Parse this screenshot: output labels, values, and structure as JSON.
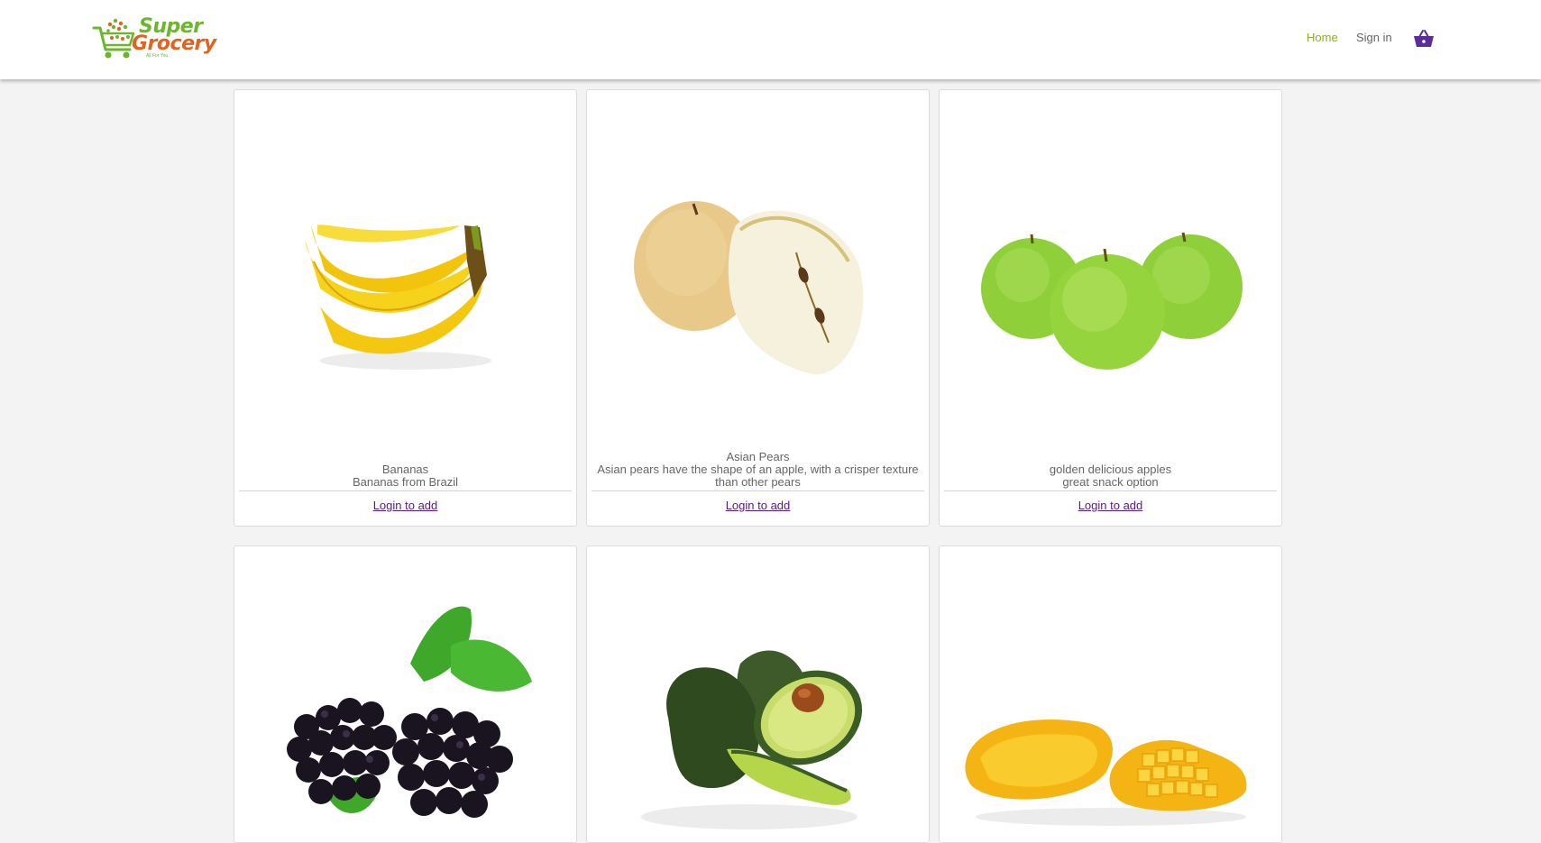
{
  "brand": {
    "name_line1": "Super",
    "name_line2": "Grocery",
    "tagline": "All For You"
  },
  "nav": {
    "home_label": "Home",
    "signin_label": "Sign in",
    "cart_icon": "basket-icon"
  },
  "colors": {
    "accent_green": "#8db10f",
    "link_visited": "#551a8b",
    "cart_purple": "#5b2d9a",
    "logo_green": "#6cb52d",
    "logo_orange": "#e2631f"
  },
  "products": [
    {
      "title": "Bananas",
      "description": "Bananas from Brazil",
      "action": "Login to add",
      "image": "bananas-image"
    },
    {
      "title": "Asian Pears",
      "description": "Asian pears have the shape of an apple, with a crisper texture than other pears",
      "action": "Login to add",
      "image": "asian-pears-image"
    },
    {
      "title": "golden delicious apples",
      "description": "great snack option",
      "action": "Login to add",
      "image": "green-apples-image"
    },
    {
      "title": "",
      "description": "",
      "action": "",
      "image": "blackberries-image"
    },
    {
      "title": "",
      "description": "",
      "action": "",
      "image": "avocados-image"
    },
    {
      "title": "",
      "description": "",
      "action": "",
      "image": "mangoes-image"
    }
  ]
}
